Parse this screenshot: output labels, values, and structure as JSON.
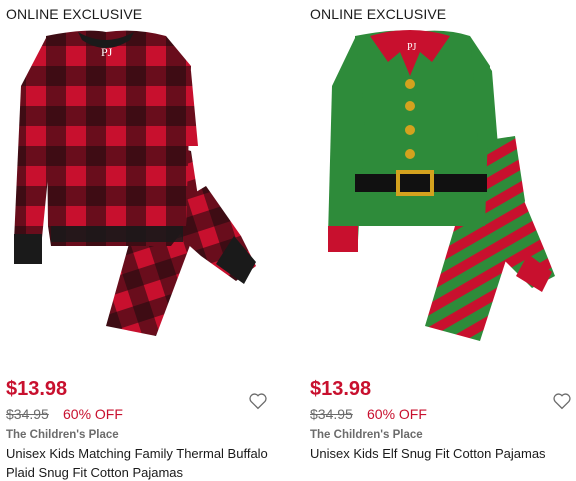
{
  "products": [
    {
      "badge": "ONLINE EXCLUSIVE",
      "image_icon": "buffalo-plaid-pajamas-image",
      "price": "$13.98",
      "original_price": "$34.95",
      "discount": "60% OFF",
      "brand": "The Children's Place",
      "title": "Unisex Kids Matching Family Thermal Buffalo Plaid Snug Fit Cotton Pajamas",
      "colors": {
        "primary": "#c8102e",
        "secondary": "#111111"
      }
    },
    {
      "badge": "ONLINE EXCLUSIVE",
      "image_icon": "elf-pajamas-image",
      "price": "$13.98",
      "original_price": "$34.95",
      "discount": "60% OFF",
      "brand": "The Children's Place",
      "title": "Unisex Kids Elf Snug Fit Cotton Pajamas",
      "colors": {
        "primary": "#2e8b3a",
        "secondary": "#c8102e"
      }
    }
  ],
  "theme": {
    "sale_red": "#c8102e",
    "muted_text": "#6b6b6b"
  }
}
